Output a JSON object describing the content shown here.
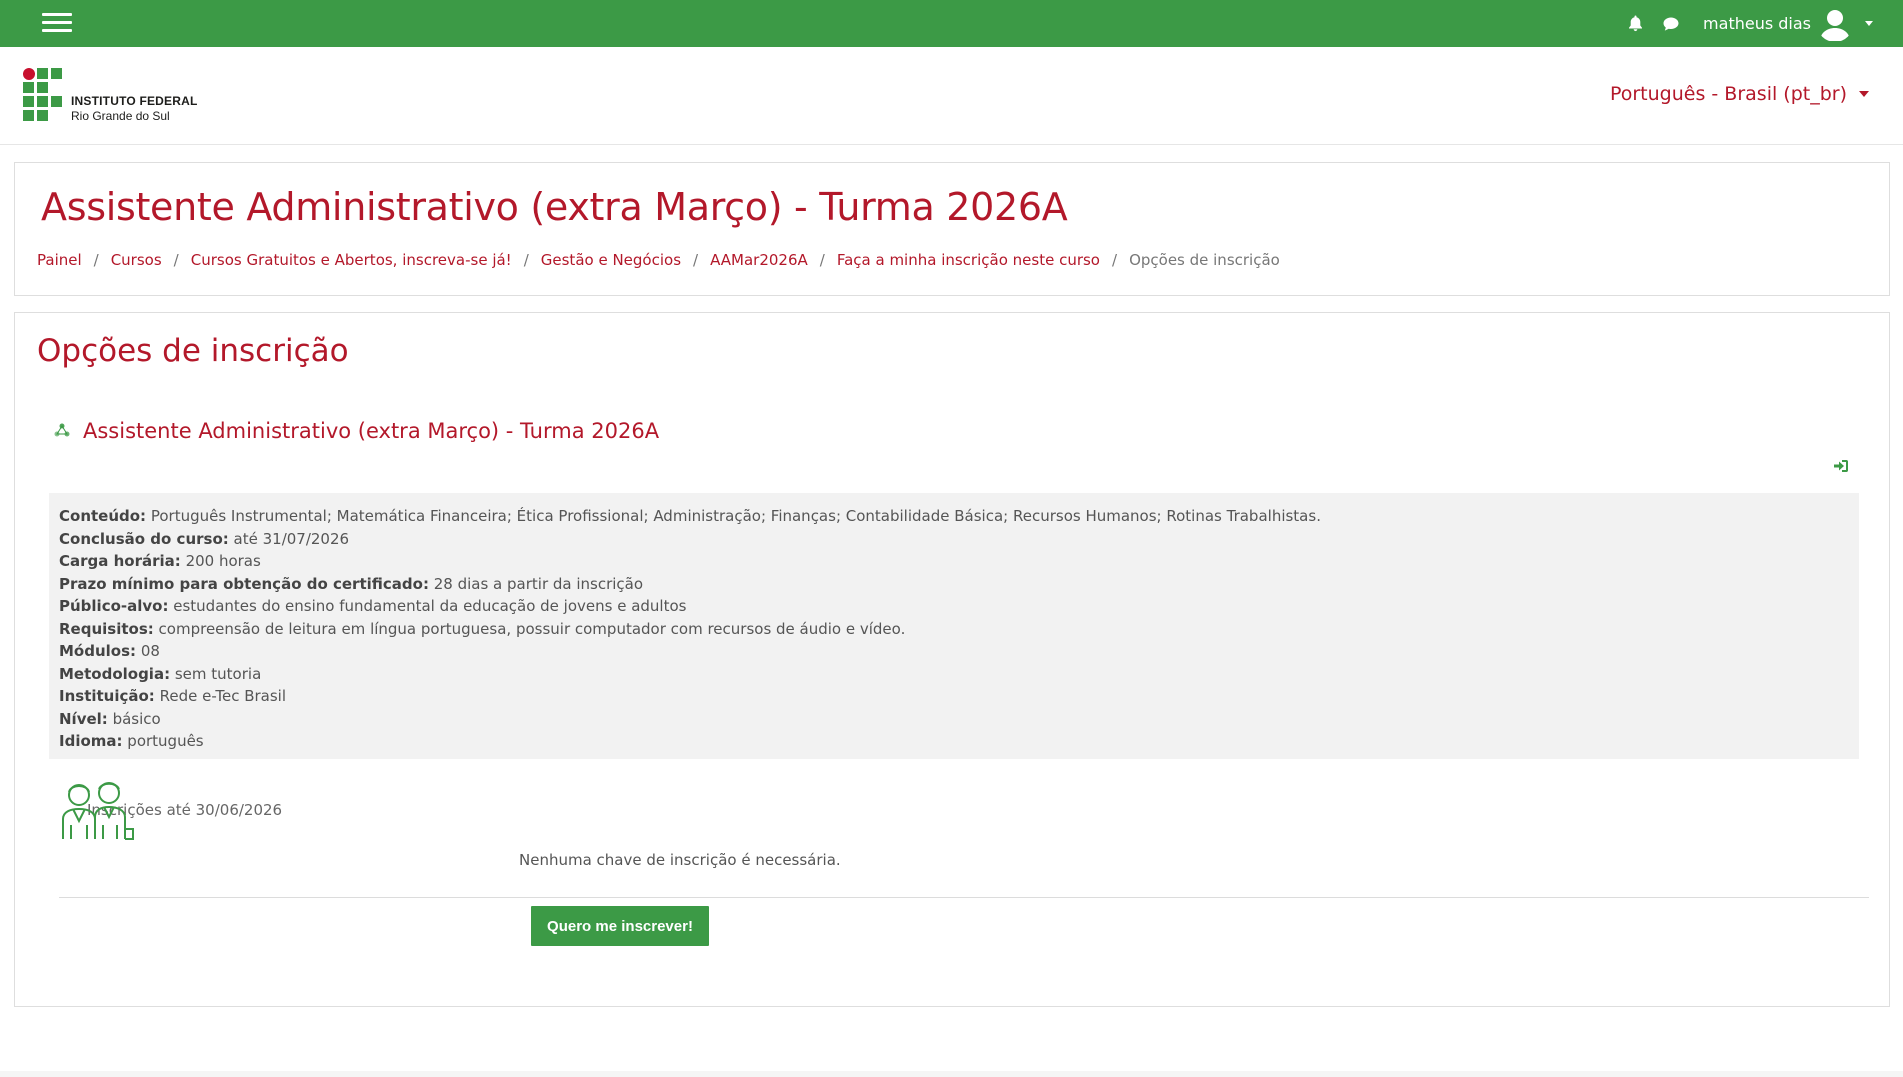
{
  "navbar": {
    "menu_label": "",
    "user_name": "matheus dias",
    "icons": [
      "menu-icon",
      "bell-icon",
      "chat-icon",
      "user-avatar-icon"
    ]
  },
  "header": {
    "logo_line1": "INSTITUTO FEDERAL",
    "logo_line2": "Rio Grande do Sul",
    "language": "Português - Brasil (pt_br)"
  },
  "page": {
    "title": "Assistente Administrativo (extra Março) - Turma 2026A",
    "breadcrumb": [
      {
        "label": "Painel"
      },
      {
        "label": "Cursos"
      },
      {
        "label": "Cursos Gratuitos e Abertos, inscreva-se já!"
      },
      {
        "label": "Gestão e Negócios"
      },
      {
        "label": "AAMar2026A"
      },
      {
        "label": "Faça a minha inscrição neste curso"
      }
    ],
    "breadcrumb_current": "Opções de inscrição"
  },
  "main": {
    "section_title": "Opções de inscrição",
    "course_name": "Assistente Administrativo (extra Março) - Turma 2026A",
    "summary": [
      {
        "label": "Conteúdo:",
        "value": "Português Instrumental; Matemática Financeira; Ética Profissional; Administração; Finanças; Contabilidade Básica; Recursos Humanos; Rotinas Trabalhistas."
      },
      {
        "label": "Conclusão do curso:",
        "value": "até 31/07/2026"
      },
      {
        "label": "Carga horária:",
        "value": "200 horas"
      },
      {
        "label": "Prazo mínimo para obtenção do certificado:",
        "value": "28 dias a partir da inscrição"
      },
      {
        "label": "Público-alvo:",
        "value": "estudantes do ensino fundamental da educação de jovens e adultos"
      },
      {
        "label": "Requisitos:",
        "value": "compreensão de leitura em língua portuguesa,  possuir computador com recursos de áudio e vídeo."
      },
      {
        "label": "Módulos:",
        "value": "08"
      },
      {
        "label": "Metodologia:",
        "value": "sem tutoria"
      },
      {
        "label": "Instituição:",
        "value": "Rede e-Tec Brasil"
      },
      {
        "label": "Nível:",
        "value": "básico"
      },
      {
        "label": "Idioma:",
        "value": "português"
      }
    ],
    "enrolment_date": "Inscrições até 30/06/2026",
    "no_key_text": "Nenhuma chave de inscrição é necessária.",
    "enrol_button": "Quero me inscrever!"
  },
  "colors": {
    "brand_green": "#3c9a46",
    "brand_red": "#b3182a"
  }
}
